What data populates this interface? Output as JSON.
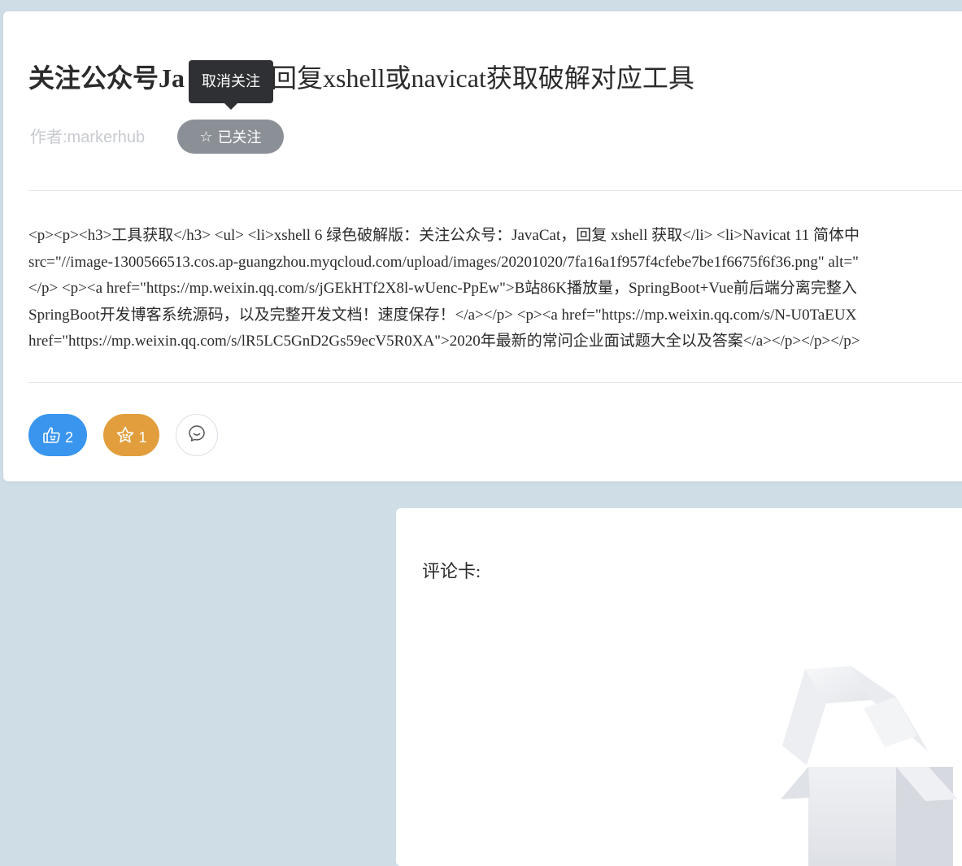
{
  "article": {
    "title_main": "关注公众号Ja",
    "title_rest": "回复xshell或navicat获取破解对应工具",
    "tooltip": "取消关注",
    "author": "作者:markerhub",
    "follow_label": "已关注",
    "content_lines": [
      "<p><p><h3>工具获取</h3> <ul> <li>xshell 6 绿色破解版：关注公众号：JavaCat，回复 xshell 获取</li> <li>Navicat 11 简体中",
      "src=\"//image-1300566513.cos.ap-guangzhou.myqcloud.com/upload/images/20201020/7fa16a1f957f4cfebe7be1f6675f6f36.png\" alt=\"",
      "</p> <p><a href=\"https://mp.weixin.qq.com/s/jGEkHTf2X8l-wUenc-PpEw\">B站86K播放量，SpringBoot+Vue前后端分离完整入",
      "SpringBoot开发博客系统源码，以及完整开发文档！速度保存！</a></p> <p><a href=\"https://mp.weixin.qq.com/s/N-U0TaEUX",
      "href=\"https://mp.weixin.qq.com/s/lR5LC5GnD2Gs59ecV5R0XA\">2020年最新的常问企业面试题大全以及答案</a></p></p></p>"
    ],
    "like_count": "2",
    "favorite_count": "1"
  },
  "comments": {
    "title": "评论卡:"
  },
  "icons": {
    "follow": "star-outline-icon",
    "like": "thumbs-up-icon",
    "favorite": "star-face-icon",
    "comment": "comment-bubble-icon",
    "empty": "empty-box-illustration"
  },
  "colors": {
    "background": "#cfdee6",
    "like": "#3a95ee",
    "favorite": "#e29e3c",
    "follow_button": "#8b8f96",
    "tooltip": "#2e3033"
  }
}
